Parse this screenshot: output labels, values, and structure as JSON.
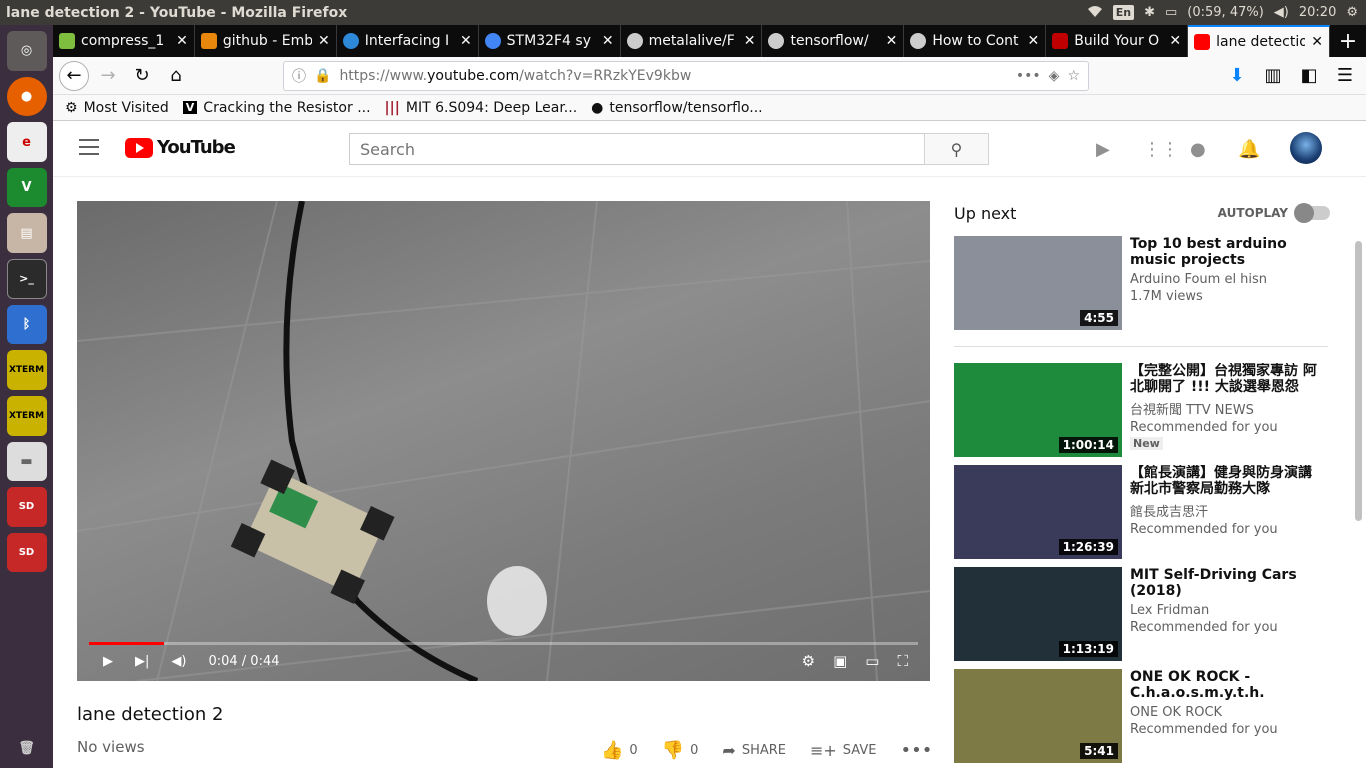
{
  "window": {
    "title": "lane detection 2 - YouTube - Mozilla Firefox",
    "keyboard": "En",
    "battery": "(0:59, 47%)",
    "clock": "20:20"
  },
  "launcher": [
    "ubuntu-icon",
    "firefox-icon",
    "text-editor-icon",
    "vim-icon",
    "files-icon",
    "terminal-icon",
    "bluetooth-icon",
    "xterm-icon",
    "xterm-icon",
    "drive-icon",
    "sd-card-icon",
    "sd-card-icon"
  ],
  "tabs": [
    {
      "label": "compress_1",
      "color": "#7fbf3f"
    },
    {
      "label": "github - Emb",
      "color": "#e8870c"
    },
    {
      "label": "Interfacing I",
      "color": "#2d88d8"
    },
    {
      "label": "STM32F4 sy",
      "color": "#4285f4"
    },
    {
      "label": "metalalive/F",
      "color": "#ffffff"
    },
    {
      "label": "tensorflow/",
      "color": "#ffffff"
    },
    {
      "label": "How to Cont",
      "color": "#ffffff"
    },
    {
      "label": "Build Your O",
      "color": "#c00000"
    },
    {
      "label": "lane detectio",
      "color": "#ff0000"
    }
  ],
  "nav": {
    "url_prefix": "https://www.",
    "url_host": "youtube.com",
    "url_path": "/watch?v=RRzkYEv9kbw"
  },
  "bookmarks": [
    "Most Visited",
    "Cracking the Resistor ...",
    "MIT 6.S094: Deep Lear...",
    "tensorflow/tensorflo..."
  ],
  "yt": {
    "logo": "YouTube",
    "search_placeholder": "Search",
    "video": {
      "time": "0:04 / 0:44",
      "progress": 0.09,
      "title": "lane detection 2",
      "views": "No views",
      "likes": "0",
      "dislikes": "0",
      "share": "SHARE",
      "save": "SAVE"
    },
    "upnext": {
      "label": "Up next",
      "autoplay": "AUTOPLAY"
    },
    "related": [
      {
        "title": "Top 10 best arduino music projects",
        "channel": "Arduino Foum el hisn",
        "meta": "1.7M views",
        "duration": "4:55",
        "badge": "",
        "thumb": "#8a8f99"
      },
      {
        "title": "【完整公開】台視獨家專訪 阿北聊開了 !!! 大談選舉恩怨",
        "channel": "台視新聞 TTV NEWS",
        "meta": "Recommended for you",
        "duration": "1:00:14",
        "badge": "New",
        "thumb": "#1d8a3c"
      },
      {
        "title": "【館長演講】健身與防身演講 新北市警察局勤務大隊",
        "channel": "館長成吉思汗",
        "meta": "Recommended for you",
        "duration": "1:26:39",
        "badge": "",
        "thumb": "#3a3a5a"
      },
      {
        "title": "MIT Self-Driving Cars (2018)",
        "channel": "Lex Fridman",
        "meta": "Recommended for you",
        "duration": "1:13:19",
        "badge": "",
        "thumb": "#22303a"
      },
      {
        "title": "ONE OK ROCK - C.h.a.o.s.m.y.t.h. [Official",
        "channel": "ONE OK ROCK",
        "meta": "Recommended for you",
        "duration": "5:41",
        "badge": "",
        "thumb": "#7d7a45"
      }
    ]
  }
}
